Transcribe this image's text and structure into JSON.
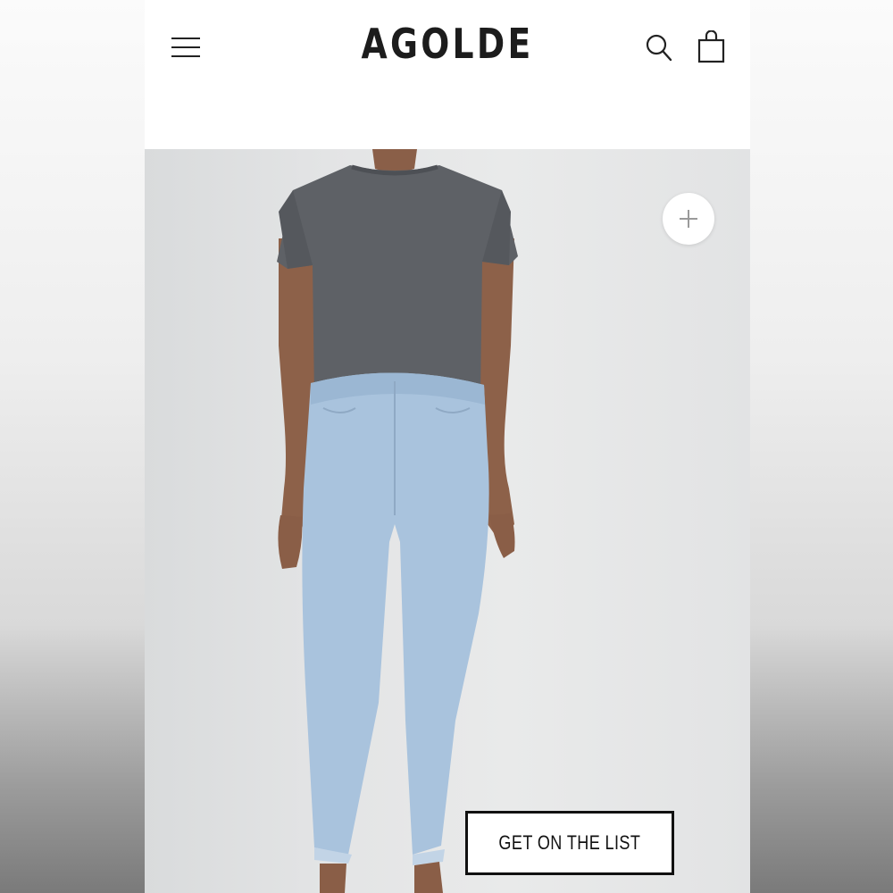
{
  "header": {
    "brand": "AGOLDE",
    "menu_icon": "hamburger-menu-icon",
    "search_icon": "search-icon",
    "cart_icon": "shopping-bag-icon"
  },
  "hero": {
    "zoom_icon": "plus-icon",
    "background_color": "#e4e5e6",
    "tee_color": "#5e6166",
    "denim_color": "#a9c3dd"
  },
  "cta": {
    "label": "GET ON THE LIST"
  }
}
